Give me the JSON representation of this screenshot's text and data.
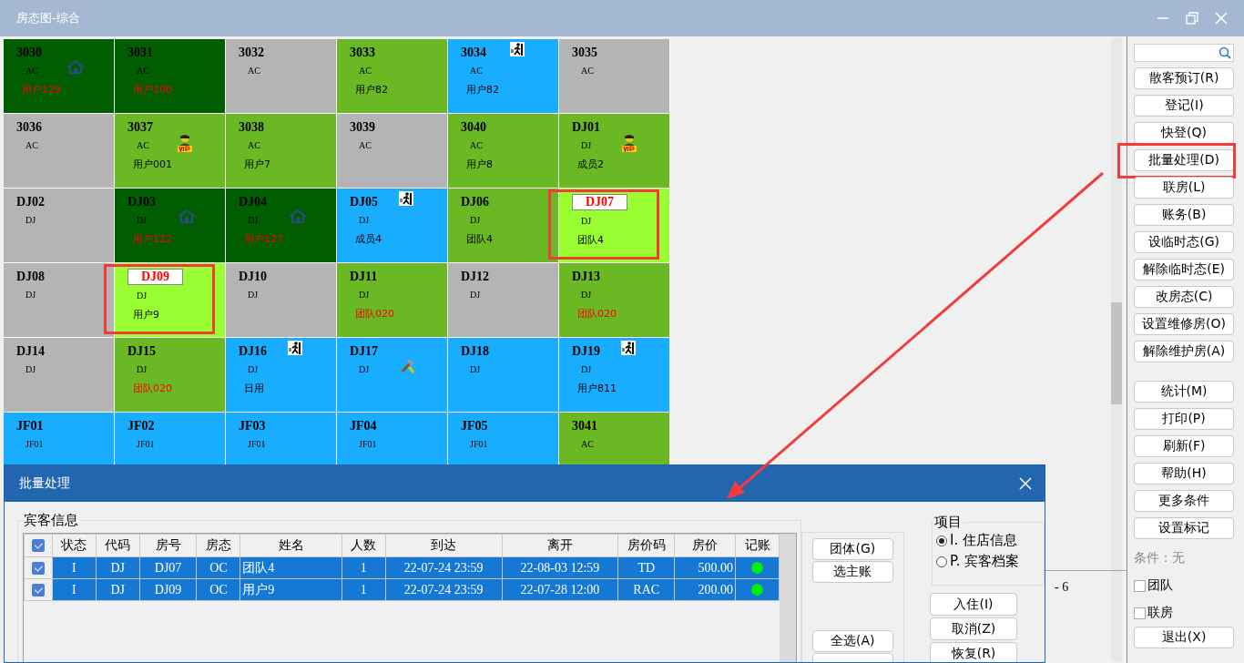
{
  "window": {
    "title": "房态图-综合"
  },
  "rooms": [
    {
      "number": "3030",
      "type": "AC",
      "guest": "用户129",
      "guest_alert": true,
      "color": "#005e00",
      "kind": "house",
      "selected": false,
      "marked": false
    },
    {
      "number": "3031",
      "type": "AC",
      "guest": "用户100",
      "guest_alert": true,
      "color": "#005e00",
      "selected": false,
      "marked": false
    },
    {
      "number": "3032",
      "type": "AC",
      "color": "#b4b4b4",
      "selected": false,
      "marked": false
    },
    {
      "number": "3033",
      "type": "AC",
      "guest": "用户82",
      "guest_alert": false,
      "color": "#6ab823",
      "selected": false,
      "marked": false
    },
    {
      "number": "3034",
      "type": "AC",
      "guest": "用户82",
      "guest_alert": false,
      "color": "#19adff",
      "kind": "runner",
      "selected": false,
      "marked": false
    },
    {
      "number": "3035",
      "type": "AC",
      "color": "#b4b4b4",
      "selected": false,
      "marked": false
    },
    {
      "number": "3036",
      "type": "AC",
      "color": "#b4b4b4",
      "selected": false,
      "marked": false
    },
    {
      "number": "3037",
      "type": "AC",
      "guest": "用户001",
      "guest_alert": false,
      "color": "#6ab823",
      "kind": "vip",
      "selected": false,
      "marked": false
    },
    {
      "number": "3038",
      "type": "AC",
      "guest": "用户7",
      "guest_alert": false,
      "color": "#6ab823",
      "selected": false,
      "marked": false
    },
    {
      "number": "3039",
      "type": "AC",
      "color": "#b4b4b4",
      "selected": false,
      "marked": false
    },
    {
      "number": "3040",
      "type": "AC",
      "guest": "用户8",
      "guest_alert": false,
      "color": "#6ab823",
      "selected": false,
      "marked": false
    },
    {
      "number": "DJ01",
      "type": "DJ",
      "guest": "成员2",
      "guest_alert": false,
      "color": "#6ab823",
      "kind": "vip",
      "selected": false,
      "marked": false
    },
    {
      "number": "DJ02",
      "type": "DJ",
      "color": "#b4b4b4",
      "selected": false,
      "marked": false
    },
    {
      "number": "DJ03",
      "type": "DJ",
      "guest": "用户122",
      "guest_alert": true,
      "color": "#005e00",
      "kind": "house",
      "selected": false,
      "marked": false
    },
    {
      "number": "DJ04",
      "type": "DJ",
      "guest": "用户127",
      "guest_alert": true,
      "color": "#005e00",
      "kind": "house",
      "selected": false,
      "marked": false
    },
    {
      "number": "DJ05",
      "type": "DJ",
      "guest": "成员4",
      "guest_alert": false,
      "color": "#19adff",
      "kind": "runner",
      "selected": false,
      "marked": false
    },
    {
      "number": "DJ06",
      "type": "DJ",
      "guest": "团队4",
      "guest_alert": false,
      "color": "#6ab823",
      "selected": false,
      "marked": false
    },
    {
      "number": "DJ07",
      "type": "DJ",
      "guest": "团队4",
      "guest_alert": false,
      "color": "#99ff33",
      "selected": true,
      "marked": true
    },
    {
      "number": "DJ08",
      "type": "DJ",
      "color": "#b4b4b4",
      "selected": false,
      "marked": false
    },
    {
      "number": "DJ09",
      "type": "DJ",
      "guest": "用户9",
      "guest_alert": false,
      "color": "#99ff33",
      "selected": true,
      "marked": true
    },
    {
      "number": "DJ10",
      "type": "DJ",
      "color": "#b4b4b4",
      "selected": false,
      "marked": false
    },
    {
      "number": "DJ11",
      "type": "DJ",
      "guest": "团队020",
      "guest_alert": true,
      "color": "#6ab823",
      "selected": false,
      "marked": false
    },
    {
      "number": "DJ12",
      "type": "DJ",
      "color": "#b4b4b4",
      "selected": false,
      "marked": false
    },
    {
      "number": "DJ13",
      "type": "DJ",
      "guest": "团队020",
      "guest_alert": true,
      "color": "#6ab823",
      "selected": false,
      "marked": false
    },
    {
      "number": "DJ14",
      "type": "DJ",
      "color": "#b4b4b4",
      "selected": false,
      "marked": false
    },
    {
      "number": "DJ15",
      "type": "DJ",
      "guest": "团队020",
      "guest_alert": true,
      "color": "#6ab823",
      "selected": false,
      "marked": false
    },
    {
      "number": "DJ16",
      "type": "DJ",
      "guest": "日用",
      "guest_alert": false,
      "color": "#19adff",
      "kind": "runner",
      "selected": false,
      "marked": false
    },
    {
      "number": "DJ17",
      "type": "DJ",
      "color": "#19adff",
      "kind": "tools",
      "selected": false,
      "marked": false
    },
    {
      "number": "DJ18",
      "type": "DJ",
      "color": "#19adff",
      "selected": false,
      "marked": false
    },
    {
      "number": "DJ19",
      "type": "DJ",
      "guest": "用户811",
      "guest_alert": false,
      "color": "#19adff",
      "kind": "runner",
      "selected": false,
      "marked": false
    },
    {
      "number": "JF01",
      "type": "JF01",
      "color": "#19adff",
      "selected": false,
      "marked": false
    },
    {
      "number": "JF02",
      "type": "JF01",
      "color": "#19adff",
      "selected": false,
      "marked": false
    },
    {
      "number": "JF03",
      "type": "JF01",
      "color": "#19adff",
      "selected": false,
      "marked": false
    },
    {
      "number": "JF04",
      "type": "JF01",
      "color": "#19adff",
      "selected": false,
      "marked": false
    },
    {
      "number": "JF05",
      "type": "JF01",
      "color": "#19adff",
      "selected": false,
      "marked": false
    },
    {
      "number": "3041",
      "type": "AC",
      "color": "#6ab823",
      "selected": false,
      "marked": false
    }
  ],
  "background_text": "- 6",
  "sidebar": {
    "button_groups": [
      {
        "buttons": [
          {
            "label": "散客预订(R)",
            "marked": false
          },
          {
            "label": "登记(I)",
            "marked": false
          },
          {
            "label": "快登(Q)",
            "marked": false
          },
          {
            "label": "批量处理(D)",
            "marked": true
          },
          {
            "label": "联房(L)",
            "marked": false
          },
          {
            "label": "账务(B)",
            "marked": false
          },
          {
            "label": "设临时态(G)",
            "marked": false
          },
          {
            "label": "解除临时态(E)",
            "marked": false
          },
          {
            "label": "改房态(C)",
            "marked": false
          },
          {
            "label": "设置维修房(O)",
            "marked": false
          },
          {
            "label": "解除维护房(A)",
            "marked": false
          }
        ]
      },
      {
        "buttons": [
          {
            "label": "统计(M)",
            "marked": false
          },
          {
            "label": "打印(P)",
            "marked": false
          },
          {
            "label": "刷新(F)",
            "marked": false
          },
          {
            "label": "帮助(H)",
            "marked": false
          },
          {
            "label": "更多条件",
            "marked": false
          },
          {
            "label": "设置标记",
            "marked": false
          }
        ]
      }
    ],
    "condition": "条件：无",
    "checkboxes": [
      {
        "label": "团队",
        "checked": false
      },
      {
        "label": "联房",
        "checked": false
      }
    ],
    "exit_button": "退出(X)"
  },
  "dialog": {
    "title": "批量处理",
    "group_title": "宾客信息",
    "header_checked": true,
    "columns": [
      "状态",
      "代码",
      "房号",
      "房态",
      "姓名",
      "人数",
      "到达",
      "离开",
      "房价码",
      "房价",
      "记账"
    ],
    "rows": [
      {
        "checked": true,
        "selected": true,
        "cells": [
          "I",
          "DJ",
          "DJ07",
          "OC",
          "团队4",
          "1",
          "22-07-24 23:59",
          "22-08-03 12:59",
          "TD",
          "500.00"
        ],
        "posted": true
      },
      {
        "checked": true,
        "selected": true,
        "cells": [
          "I",
          "DJ",
          "DJ09",
          "OC",
          "用户9",
          "1",
          "22-07-24 23:59",
          "22-07-28 12:00",
          "RAC",
          "200.00"
        ],
        "posted": true
      }
    ],
    "group_buttons": [
      "团体(G)",
      "选主账"
    ],
    "select_buttons": [
      "全选(A)"
    ],
    "project": {
      "title": "项目",
      "options": [
        {
          "label": "I. 住店信息",
          "selected": true
        },
        {
          "label": "P. 宾客档案",
          "selected": false
        }
      ]
    },
    "action_buttons": [
      "入住(I)",
      "取消(Z)",
      "恢复(R)"
    ]
  }
}
